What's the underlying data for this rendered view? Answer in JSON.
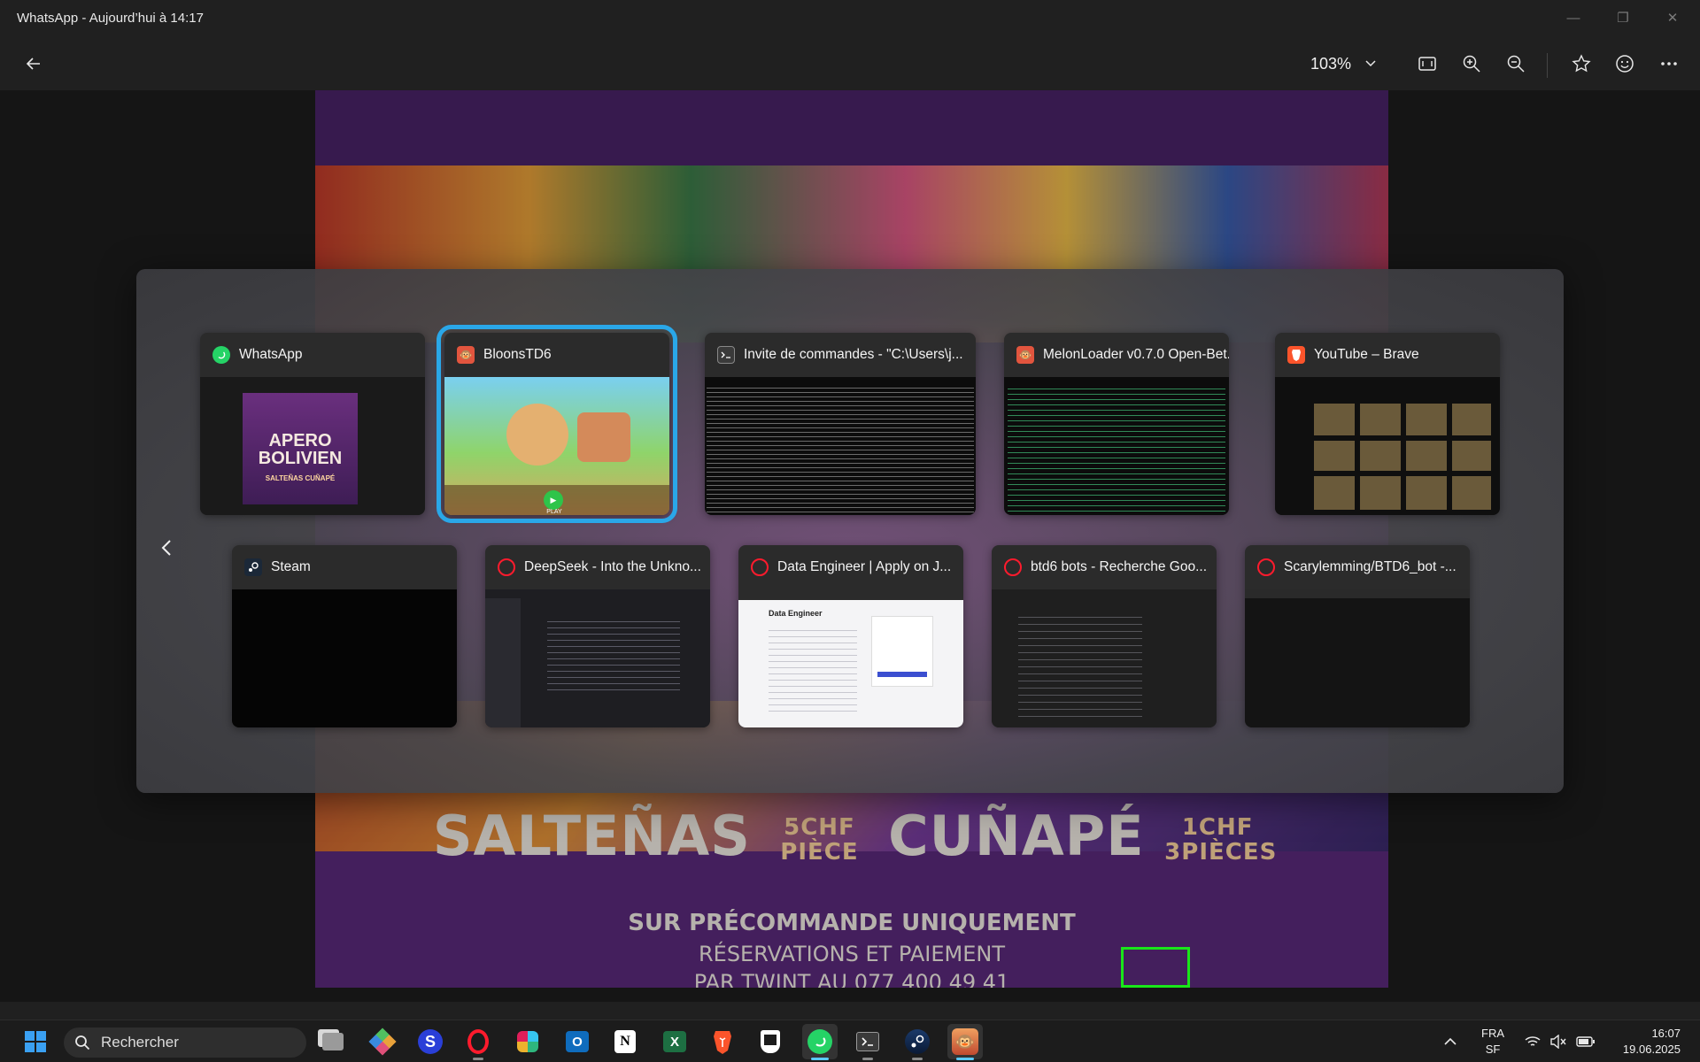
{
  "window": {
    "title": "WhatsApp - Aujourd’hui à 14:17",
    "minimize": "—",
    "maximize": "❐",
    "close": "✕"
  },
  "toolbar": {
    "zoom_level": "103%",
    "icons": [
      "back-arrow-icon",
      "fit-screen-icon",
      "zoom-in-icon",
      "zoom-out-icon",
      "star-icon",
      "emoji-icon",
      "more-icon"
    ]
  },
  "poster": {
    "line1": "SALTEÑAS",
    "price1": "5CHF PIÈCE",
    "line2": "CUÑAPÉ",
    "price2": "1CHF 3PIÈCES",
    "line3": "SUR PRÉCOMMANDE UNIQUEMENT",
    "line4": "RÉSERVATIONS ET PAIEMENT",
    "line5": "PAR TWINT AU 077 400 49 41",
    "thumb_title": "APERO BOLIVIEN",
    "thumb_sub": "SALTEÑAS CUÑAPÉ"
  },
  "switcher": {
    "cards": [
      {
        "label": "WhatsApp",
        "icon": "whatsapp-icon"
      },
      {
        "label": "BloonsTD6",
        "icon": "bloons-icon",
        "selected": true
      },
      {
        "label": "Invite de commandes - \"C:\\Users\\j...",
        "icon": "terminal-icon"
      },
      {
        "label": "MelonLoader v0.7.0 Open-Bet...",
        "icon": "melonloader-icon"
      },
      {
        "label": "YouTube – Brave",
        "icon": "brave-icon"
      },
      {
        "label": "Steam",
        "icon": "steam-icon"
      },
      {
        "label": "DeepSeek - Into the Unkno...",
        "icon": "opera-icon"
      },
      {
        "label": "Data Engineer | Apply on J...",
        "icon": "opera-icon"
      },
      {
        "label": "btd6 bots - Recherche Goo...",
        "icon": "opera-icon"
      },
      {
        "label": "Scarylemming/BTD6_bot -...",
        "icon": "opera-icon"
      }
    ],
    "thumb_texts": {
      "data_engineer": "Data Engineer",
      "bloons_play": "PLAY"
    }
  },
  "taskbar": {
    "search_placeholder": "Rechercher",
    "apps": [
      "task-view",
      "git",
      "s-app",
      "opera-gx",
      "slack",
      "outlook",
      "notion",
      "excel",
      "brave",
      "epic",
      "whatsapp",
      "terminal",
      "steam",
      "bloons"
    ],
    "lang": "FRA",
    "layout": "SF",
    "time": "16:07",
    "date": "19.06.2025"
  },
  "colors": {
    "accent_selected": "#2aa7e8",
    "whatsapp": "#25d366",
    "opera": "#ff1b2d",
    "brave": "#fb542b",
    "excel": "#1d6f42",
    "poster_purple": "#5b2a7c"
  }
}
